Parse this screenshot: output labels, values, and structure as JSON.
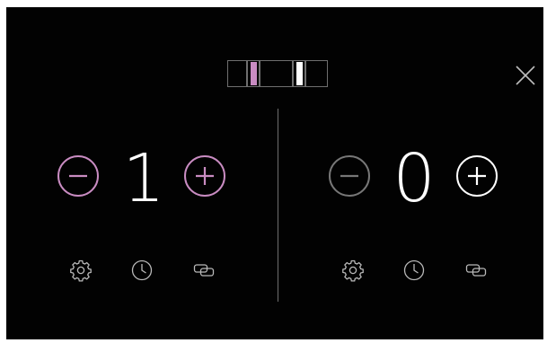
{
  "colors": {
    "background": "#020202",
    "accent": "#c98cc2",
    "active_white": "#ffffff",
    "inactive": "#777777",
    "icon": "#b9b9b9"
  },
  "zones_indicator": {
    "icon": "cooktop-zones-icon",
    "selected_zone_color": "#c98cc2"
  },
  "close_button": {
    "icon": "close-icon"
  },
  "left_zone": {
    "level": "1",
    "decrease_icon": "minus-icon",
    "increase_icon": "plus-icon",
    "settings_icon": "gear-icon",
    "timer_icon": "clock-icon",
    "link_icon": "link-zones-icon"
  },
  "right_zone": {
    "level": "0",
    "decrease_icon": "minus-icon",
    "increase_icon": "plus-icon",
    "settings_icon": "gear-icon",
    "timer_icon": "clock-icon",
    "link_icon": "link-zones-icon"
  }
}
